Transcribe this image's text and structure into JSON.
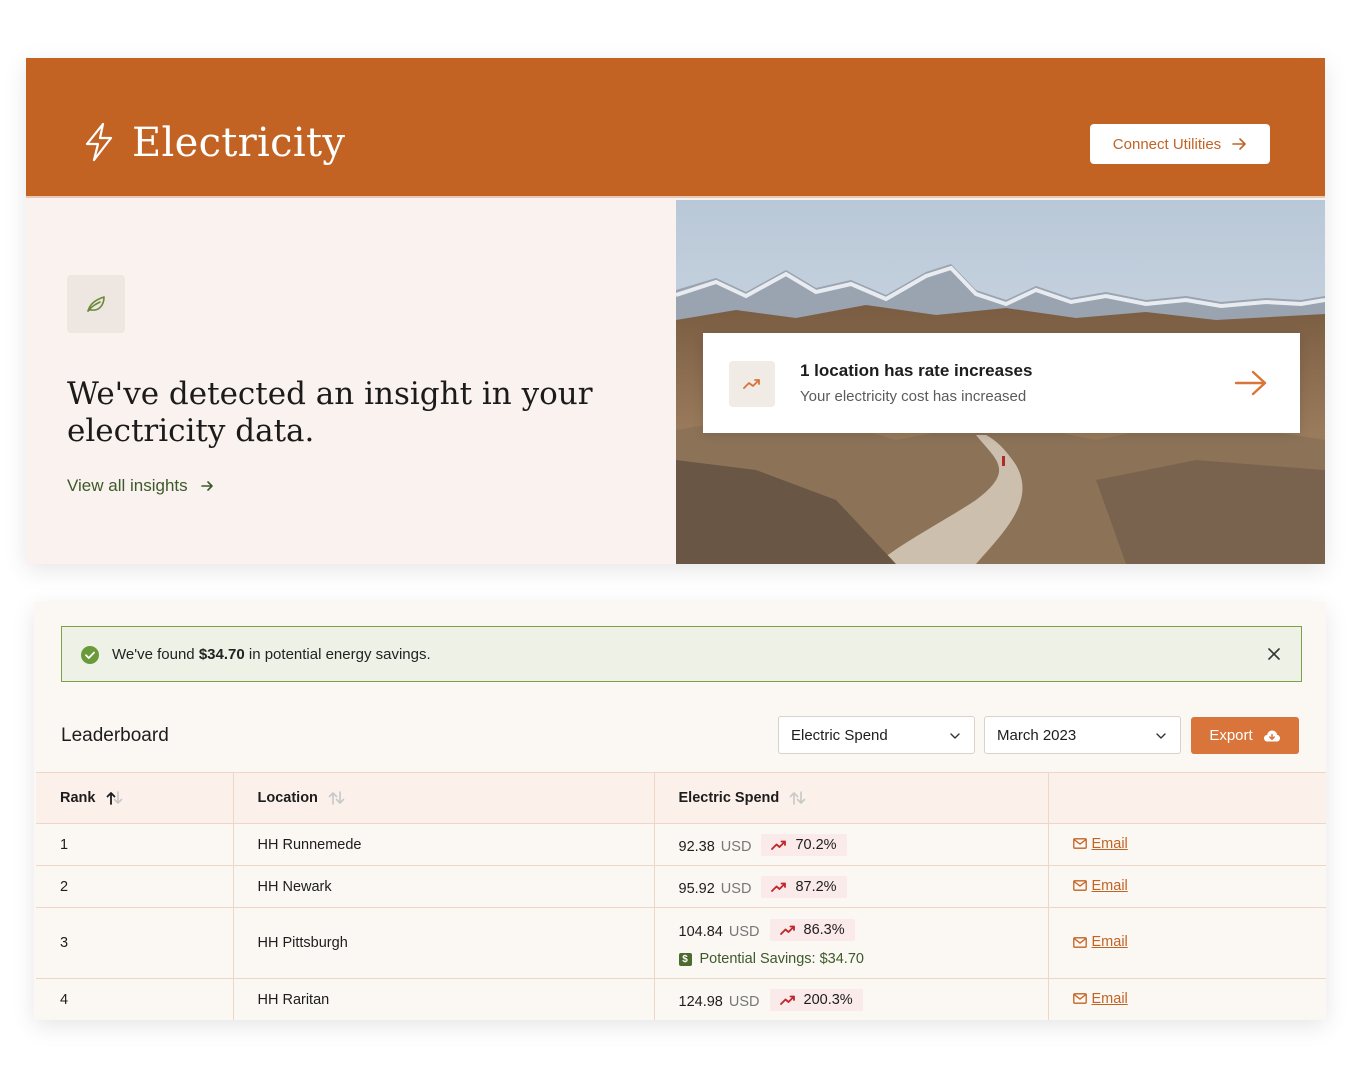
{
  "header": {
    "title": "Electricity",
    "connect_button": "Connect Utilities",
    "brand_color": "#c26324"
  },
  "insight": {
    "heading": "We've detected an insight in your electricity data.",
    "view_all": "View all insights",
    "rate_card": {
      "title": "1 location has rate increases",
      "subtitle": "Your electricity cost has increased"
    }
  },
  "alert": {
    "prefix": "We've found ",
    "amount": "$34.70",
    "suffix": " in potential energy savings."
  },
  "leaderboard": {
    "title": "Leaderboard",
    "metric_select": "Electric Spend",
    "month_select": "March 2023",
    "export_button": "Export",
    "columns": [
      "Rank",
      "Location",
      "Electric Spend",
      ""
    ],
    "rows": [
      {
        "rank": "1",
        "location": "HH Runnemede",
        "spend": "92.38",
        "unit": "USD",
        "change": "70.2%",
        "email": "Email"
      },
      {
        "rank": "2",
        "location": "HH Newark",
        "spend": "95.92",
        "unit": "USD",
        "change": "87.2%",
        "email": "Email"
      },
      {
        "rank": "3",
        "location": "HH Pittsburgh",
        "spend": "104.84",
        "unit": "USD",
        "change": "86.3%",
        "savings": "Potential Savings: $34.70",
        "email": "Email"
      },
      {
        "rank": "4",
        "location": "HH Raritan",
        "spend": "124.98",
        "unit": "USD",
        "change": "200.3%",
        "email": "Email"
      }
    ]
  }
}
